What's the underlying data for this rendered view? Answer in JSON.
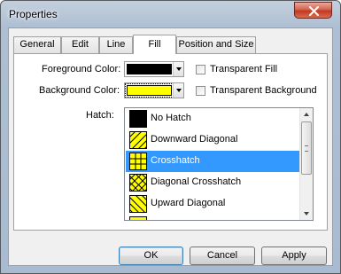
{
  "window": {
    "title": "Properties"
  },
  "tabs": [
    {
      "label": "General"
    },
    {
      "label": "Edit"
    },
    {
      "label": "Line"
    },
    {
      "label": "Fill",
      "active": true
    },
    {
      "label": "Position and Size"
    }
  ],
  "fill": {
    "foreground_label": "Foreground Color:",
    "foreground_color": "#000000",
    "background_label": "Background Color:",
    "background_color": "#ffff00",
    "transparent_fill_label": "Transparent Fill",
    "transparent_fill_checked": false,
    "transparent_background_label": "Transparent Background",
    "transparent_background_checked": false,
    "hatch_label": "Hatch:",
    "hatch_options": [
      {
        "label": "No Hatch",
        "icon": "no-hatch-swatch-icon"
      },
      {
        "label": "Downward Diagonal",
        "icon": "downward-diagonal-swatch-icon"
      },
      {
        "label": "Crosshatch",
        "icon": "crosshatch-swatch-icon",
        "selected": true
      },
      {
        "label": "Diagonal Crosshatch",
        "icon": "diagonal-crosshatch-swatch-icon"
      },
      {
        "label": "Upward Diagonal",
        "icon": "upward-diagonal-swatch-icon"
      }
    ]
  },
  "buttons": {
    "ok": "OK",
    "cancel": "Cancel",
    "apply": "Apply"
  },
  "colors": {
    "selection": "#3399ff",
    "swatch_fill": "#ffff00",
    "hatch_line": "#000000"
  }
}
